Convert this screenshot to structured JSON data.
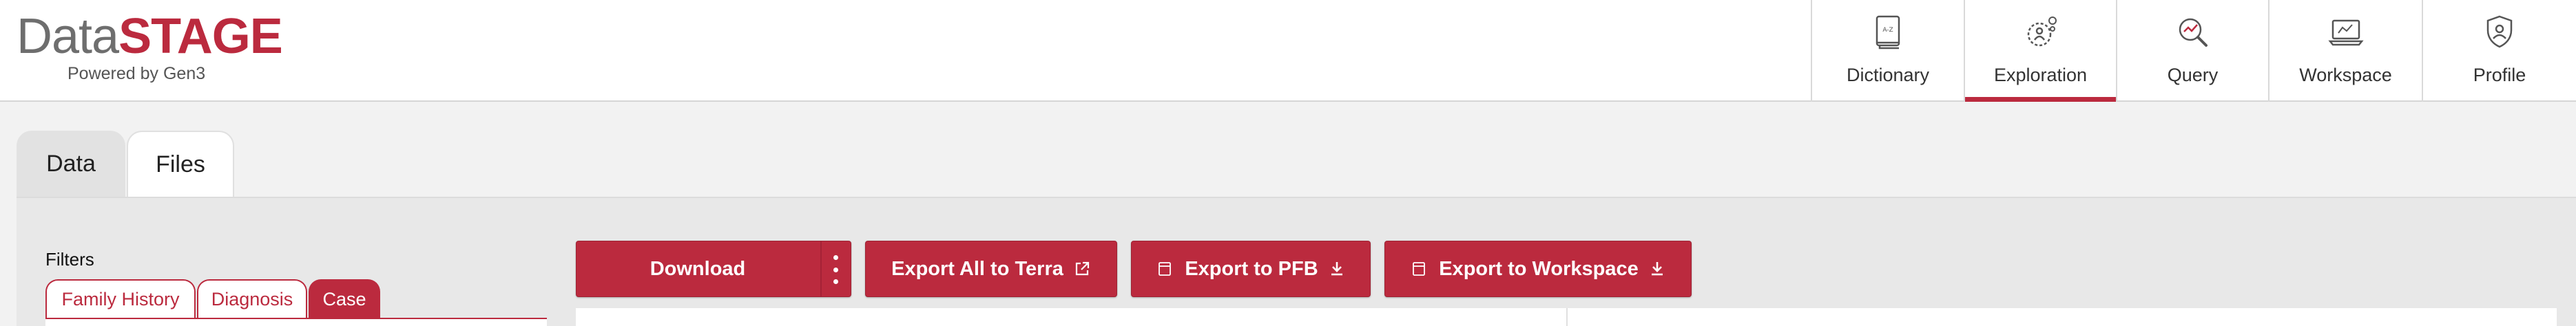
{
  "logo": {
    "part1": "Data",
    "part2": "STAGE",
    "subtitle": "Powered by Gen3"
  },
  "nav": {
    "items": [
      {
        "label": "Dictionary",
        "icon": "dictionary-icon",
        "active": false
      },
      {
        "label": "Exploration",
        "icon": "exploration-icon",
        "active": true
      },
      {
        "label": "Query",
        "icon": "query-icon",
        "active": false
      },
      {
        "label": "Workspace",
        "icon": "workspace-icon",
        "active": false
      },
      {
        "label": "Profile",
        "icon": "profile-icon",
        "active": false
      }
    ]
  },
  "tabs": [
    {
      "label": "Data",
      "active": false
    },
    {
      "label": "Files",
      "active": true
    }
  ],
  "filters": {
    "title": "Filters",
    "tabs": [
      {
        "label": "Family History",
        "active": false
      },
      {
        "label": "Diagnosis",
        "active": false
      },
      {
        "label": "Case",
        "active": true
      }
    ]
  },
  "actions": {
    "download": "Download",
    "export_terra": "Export All to Terra",
    "export_pfb": "Export to PFB",
    "export_workspace": "Export to Workspace"
  },
  "colors": {
    "accent": "#bb2a3e",
    "header_bg": "#ffffff",
    "page_bg": "#f2f2f2"
  }
}
